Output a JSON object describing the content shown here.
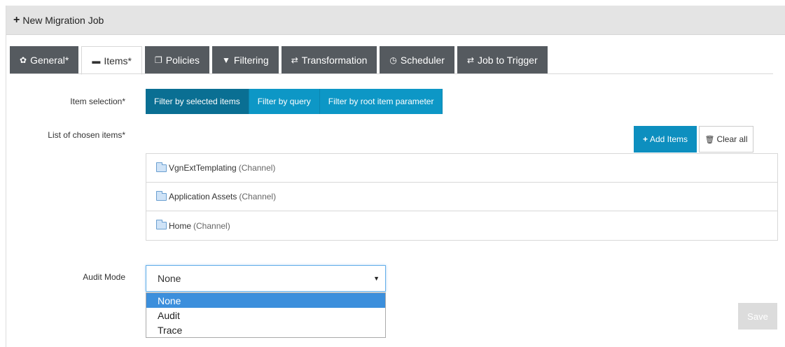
{
  "header": {
    "title": "New Migration Job",
    "icon": "plus-icon"
  },
  "tabs": [
    {
      "label": "General*",
      "icon": "gear-icon",
      "active": false
    },
    {
      "label": "Items*",
      "icon": "archive-icon",
      "active": true
    },
    {
      "label": "Policies",
      "icon": "copy-icon",
      "active": false
    },
    {
      "label": "Filtering",
      "icon": "filter-icon",
      "active": false
    },
    {
      "label": "Transformation",
      "icon": "exchange-icon",
      "active": false
    },
    {
      "label": "Scheduler",
      "icon": "clock-icon",
      "active": false
    },
    {
      "label": "Job to Trigger",
      "icon": "exchange-icon",
      "active": false
    }
  ],
  "item_selection": {
    "label": "Item selection*",
    "options": [
      {
        "label": "Filter by selected items",
        "active": true
      },
      {
        "label": "Filter by query",
        "active": false
      },
      {
        "label": "Filter by root item parameter",
        "active": false
      }
    ]
  },
  "chosen_items": {
    "label": "List of chosen items*",
    "add_label": "Add Items",
    "clear_label": "Clear all",
    "items": [
      {
        "name": "VgnExtTemplating",
        "type": "(Channel)",
        "icon": "folder-icon"
      },
      {
        "name": "Application Assets",
        "type": "(Channel)",
        "icon": "folder-icon"
      },
      {
        "name": "Home",
        "type": "(Channel)",
        "icon": "folder-icon"
      }
    ]
  },
  "audit_mode": {
    "label": "Audit Mode",
    "value": "None",
    "options": [
      "None",
      "Audit",
      "Trace"
    ],
    "selected_option": "None"
  },
  "save_label": "Save",
  "colors": {
    "primary": "#0d97c6",
    "primary_active": "#0a6f93",
    "tab_dark": "#555a5f",
    "highlight": "#3c8fdc"
  }
}
